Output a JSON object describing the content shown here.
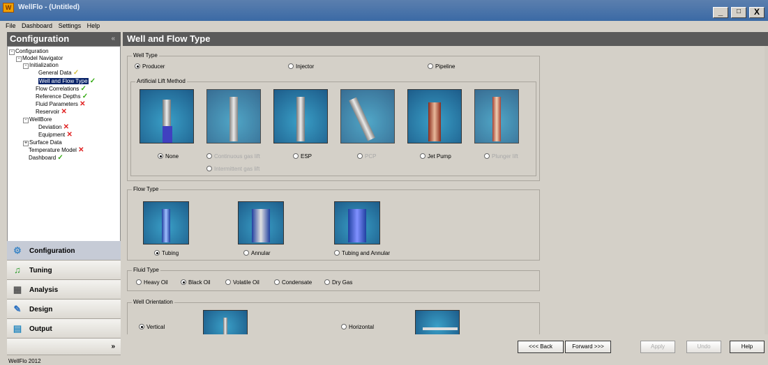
{
  "app": {
    "title": "WellFlo - (Untitled)",
    "logo": "W",
    "status": "WellFlo 2012"
  },
  "window_buttons": [
    "_",
    "□",
    "X"
  ],
  "menu": [
    "File",
    "Dashboard",
    "Settings",
    "Help"
  ],
  "sidebar": {
    "header": "Configuration",
    "collapse_icon": "«",
    "tree": [
      {
        "label": "Configuration",
        "expander": "-"
      },
      {
        "label": "Model Navigator",
        "expander": "-"
      },
      {
        "label": "Initialization",
        "expander": "-"
      },
      {
        "label": "General Data",
        "status": "✓"
      },
      {
        "label": "Well and Flow Type",
        "status": "✓"
      },
      {
        "label": "Flow Correlations",
        "status": "✓"
      },
      {
        "label": "Reference Depths",
        "status": "✓"
      },
      {
        "label": "Fluid Parameters",
        "status": "✕"
      },
      {
        "label": "Reservoir",
        "status": "✕"
      },
      {
        "label": "WellBore",
        "expander": "-"
      },
      {
        "label": "Deviation",
        "status": "✕"
      },
      {
        "label": "Equipment",
        "status": "✕"
      },
      {
        "label": "Surface Data",
        "expander": "+"
      },
      {
        "label": "Temperature Model",
        "status": "✕"
      },
      {
        "label": "Dashboard",
        "status": "✓"
      }
    ],
    "scroll_left": "◂",
    "scroll_right": "▸",
    "scroll_dots": "..........",
    "nav": [
      {
        "label": "Configuration",
        "icon": "gear-icon",
        "glyph": "⚙",
        "color": "#3c86c6"
      },
      {
        "label": "Tuning",
        "icon": "music-note-icon",
        "glyph": "♫",
        "color": "#2a9a2a"
      },
      {
        "label": "Analysis",
        "icon": "calculator-icon",
        "glyph": "▦",
        "color": "#555"
      },
      {
        "label": "Design",
        "icon": "pencil-icon",
        "glyph": "✎",
        "color": "#2a70c0"
      },
      {
        "label": "Output",
        "icon": "output-grid-icon",
        "glyph": "▤",
        "color": "#2a8ac0"
      }
    ],
    "more": "»"
  },
  "main": {
    "header": "Well and Flow Type",
    "well_type": {
      "caption": "Well Type",
      "options": [
        "Producer",
        "Injector",
        "Pipeline"
      ],
      "selected": "Producer"
    },
    "lift": {
      "caption": "Artificial Lift Method",
      "options": [
        "None",
        "Continuous gas lift",
        "ESP",
        "PCP",
        "Jet Pump",
        "Plunger lift",
        "Intermittent gas lift"
      ],
      "selected": "None"
    },
    "flow": {
      "caption": "Flow Type",
      "options": [
        "Tubing",
        "Annular",
        "Tubing and Annular"
      ],
      "selected": "Tubing"
    },
    "fluid": {
      "caption": "Fluid Type",
      "options": [
        "Heavy Oil",
        "Black Oil",
        "Volatile Oil",
        "Condensate",
        "Dry Gas"
      ],
      "selected": "Black Oil"
    },
    "orientation": {
      "caption": "Well Orientation",
      "options": [
        "Vertical",
        "Horizontal"
      ],
      "selected": "Vertical"
    }
  },
  "buttons": {
    "back": "<<< Back",
    "forward": "Forward >>>",
    "apply": "Apply",
    "undo": "Undo",
    "help": "Help"
  }
}
